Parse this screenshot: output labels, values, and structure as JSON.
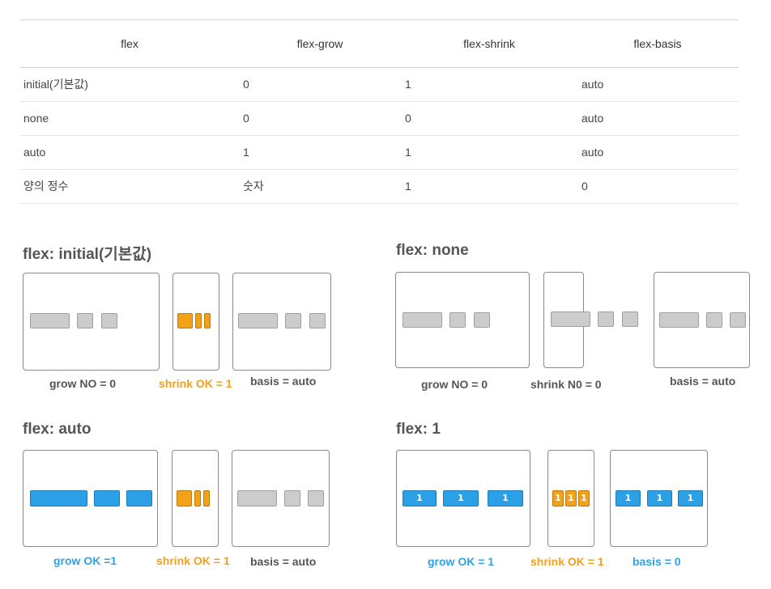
{
  "table": {
    "headers": [
      "flex",
      "flex-grow",
      "flex-shrink",
      "flex-basis"
    ],
    "rows": [
      [
        "initial(기본값)",
        "0",
        "1",
        "auto"
      ],
      [
        "none",
        "0",
        "0",
        "auto"
      ],
      [
        "auto",
        "1",
        "1",
        "auto"
      ],
      [
        "양의 정수",
        "숫자",
        "1",
        "0"
      ]
    ]
  },
  "diagrams": {
    "initial": {
      "title": "flex: initial(기본값)",
      "grow": "grow NO = 0",
      "shrink": "shrink OK = 1",
      "basis": "basis = auto"
    },
    "none": {
      "title": "flex: none",
      "grow": "grow NO = 0",
      "shrink": "shrink N0 = 0",
      "basis": "basis = auto"
    },
    "auto": {
      "title": "flex: auto",
      "grow": "grow OK =1",
      "shrink": "shrink OK = 1",
      "basis": "basis = auto"
    },
    "one": {
      "title": "flex: 1",
      "grow": "grow OK = 1",
      "shrink": "shrink OK = 1",
      "basis": "basis = 0",
      "item_label": "1"
    }
  },
  "colors": {
    "gray_item": "#cccccc",
    "orange_item": "#f4a11a",
    "blue_item": "#2ca0e6",
    "orange_text": "#f0a020",
    "blue_text": "#2ea2e4"
  }
}
